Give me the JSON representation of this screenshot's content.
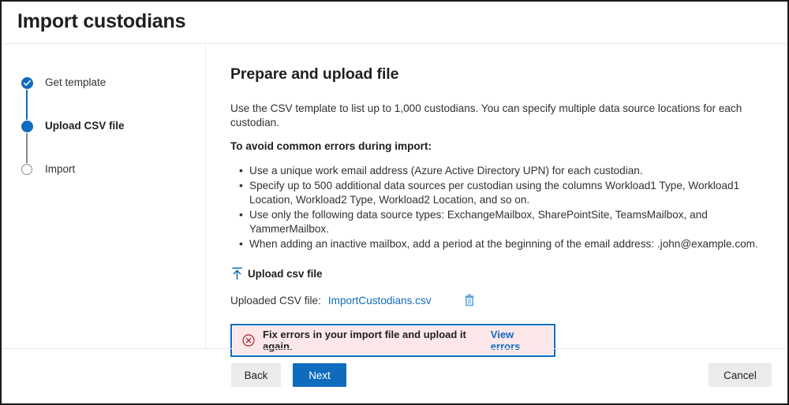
{
  "window": {
    "title": "Import custodians"
  },
  "stepper": {
    "steps": [
      {
        "label": "Get template",
        "state": "done",
        "icon": "check-circle-icon"
      },
      {
        "label": "Upload CSV file",
        "state": "current",
        "icon": "filled-circle-icon"
      },
      {
        "label": "Import",
        "state": "todo",
        "icon": "empty-circle-icon"
      }
    ]
  },
  "main": {
    "heading": "Prepare and upload file",
    "intro": "Use the CSV template to list up to 1,000 custodians. You can specify multiple data source locations for each custodian.",
    "subheading": "To avoid common errors during import:",
    "tips": [
      "Use a unique work email address (Azure Active Directory UPN) for each custodian.",
      "Specify up to 500 additional data sources per custodian using the columns Workload1 Type, Workload1 Location, Workload2 Type, Workload2 Location, and so on.",
      "Use only the following data source types: ExchangeMailbox, SharePointSite, TeamsMailbox, and YammerMailbox.",
      "When adding an inactive mailbox, add a period at the beginning of the email address: .john@example.com."
    ],
    "upload": {
      "button_label": "Upload csv file",
      "icon": "upload-arrow-icon",
      "uploaded_label": "Uploaded CSV file:",
      "uploaded_file": "ImportCustodians.csv",
      "delete_icon": "trash-icon"
    },
    "error": {
      "icon": "error-circle-x-icon",
      "message": "Fix errors in your import file and upload it again.",
      "link_label": "View errors"
    }
  },
  "footer": {
    "back_label": "Back",
    "next_label": "Next",
    "cancel_label": "Cancel"
  },
  "colors": {
    "accent": "#0f6cbd",
    "error_bg": "#fde7e9",
    "error_icon": "#a4262c",
    "text": "#323130",
    "divider": "#eceaea",
    "secondary_button": "#ebebeb"
  }
}
